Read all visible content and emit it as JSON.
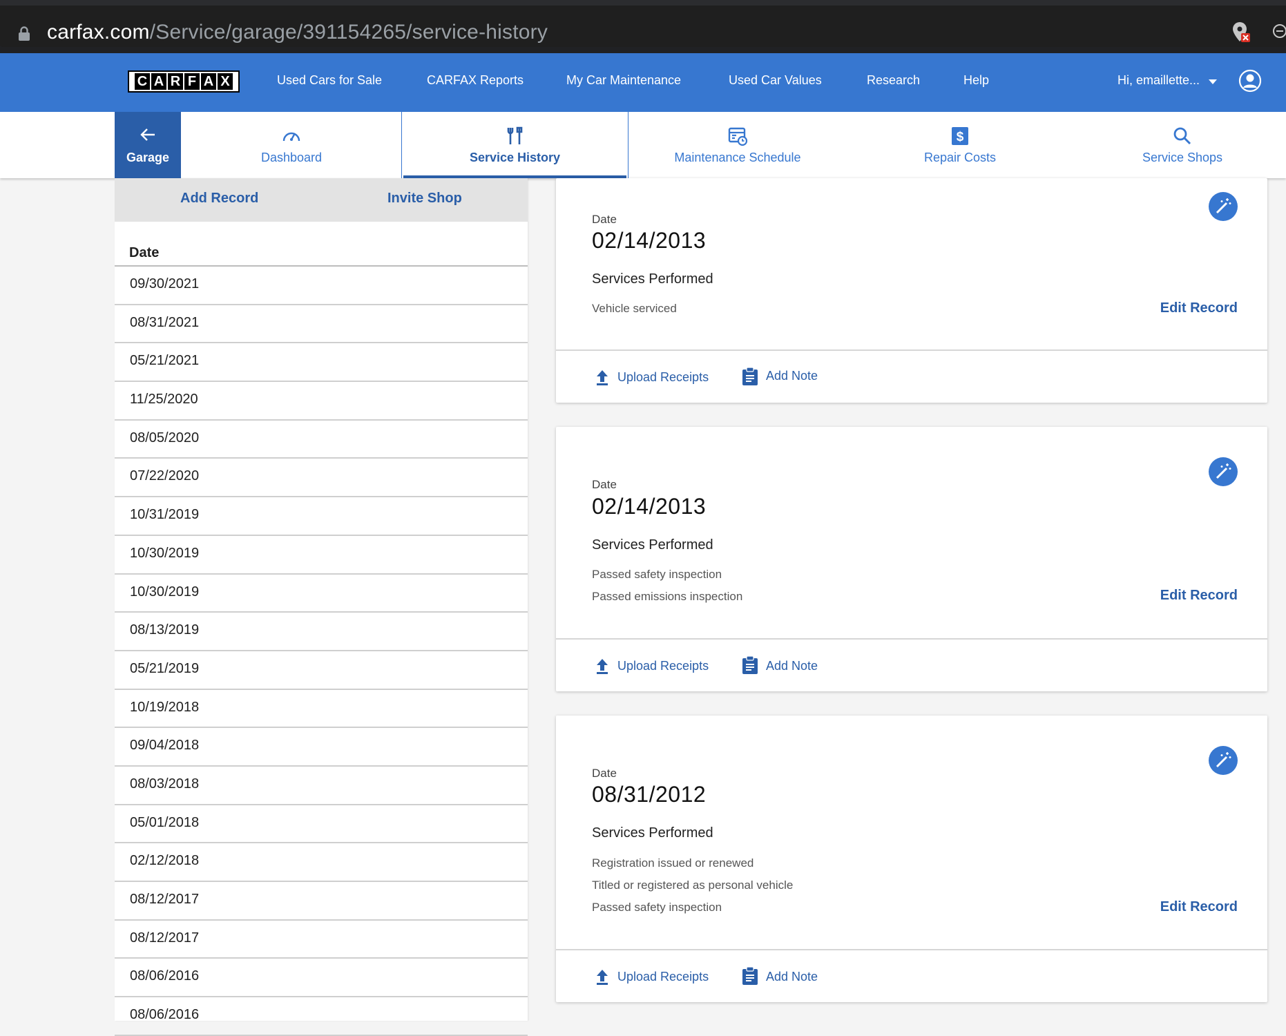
{
  "browser": {
    "url_host": "carfax.com",
    "url_path": "/Service/garage/391154265/service-history"
  },
  "topnav": {
    "links": [
      "Used Cars for Sale",
      "CARFAX Reports",
      "My Car Maintenance",
      "Used Car Values",
      "Research",
      "Help"
    ],
    "user_greeting": "Hi, emaillette...",
    "logo_letters": [
      "C",
      "A",
      "R",
      "F",
      "A",
      "X"
    ]
  },
  "subnav": {
    "garage_label": "Garage",
    "tabs": [
      {
        "label": "Dashboard",
        "icon": "speedometer-icon"
      },
      {
        "label": "Service History",
        "icon": "tools-icon",
        "active": true
      },
      {
        "label": "Maintenance Schedule",
        "icon": "calendar-clock-icon"
      },
      {
        "label": "Repair Costs",
        "icon": "dollar-icon"
      },
      {
        "label": "Service Shops",
        "icon": "search-icon"
      }
    ]
  },
  "left_panel": {
    "add_record": "Add Record",
    "invite_shop": "Invite Shop",
    "date_header": "Date",
    "dates": [
      "09/30/2021",
      "08/31/2021",
      "05/21/2021",
      "11/25/2020",
      "08/05/2020",
      "07/22/2020",
      "10/31/2019",
      "10/30/2019",
      "10/30/2019",
      "08/13/2019",
      "05/21/2019",
      "10/19/2018",
      "09/04/2018",
      "08/03/2018",
      "05/01/2018",
      "02/12/2018",
      "08/12/2017",
      "08/12/2017",
      "08/06/2016",
      "08/06/2016"
    ]
  },
  "records": [
    {
      "date_label": "Date",
      "date": "02/14/2013",
      "services_label": "Services Performed",
      "services": [
        "Vehicle serviced"
      ],
      "edit_label": "Edit Record",
      "upload_label": "Upload Receipts",
      "note_label": "Add Note"
    },
    {
      "date_label": "Date",
      "date": "02/14/2013",
      "services_label": "Services Performed",
      "services": [
        "Passed safety inspection",
        "Passed emissions inspection"
      ],
      "edit_label": "Edit Record",
      "upload_label": "Upload Receipts",
      "note_label": "Add Note"
    },
    {
      "date_label": "Date",
      "date": "08/31/2012",
      "services_label": "Services Performed",
      "services": [
        "Registration issued or renewed",
        "Titled or registered as personal vehicle",
        "Passed safety inspection"
      ],
      "edit_label": "Edit Record",
      "upload_label": "Upload Receipts",
      "note_label": "Add Note"
    }
  ],
  "colors": {
    "brand_blue": "#3777d0",
    "dark_blue": "#2a5ea8"
  }
}
